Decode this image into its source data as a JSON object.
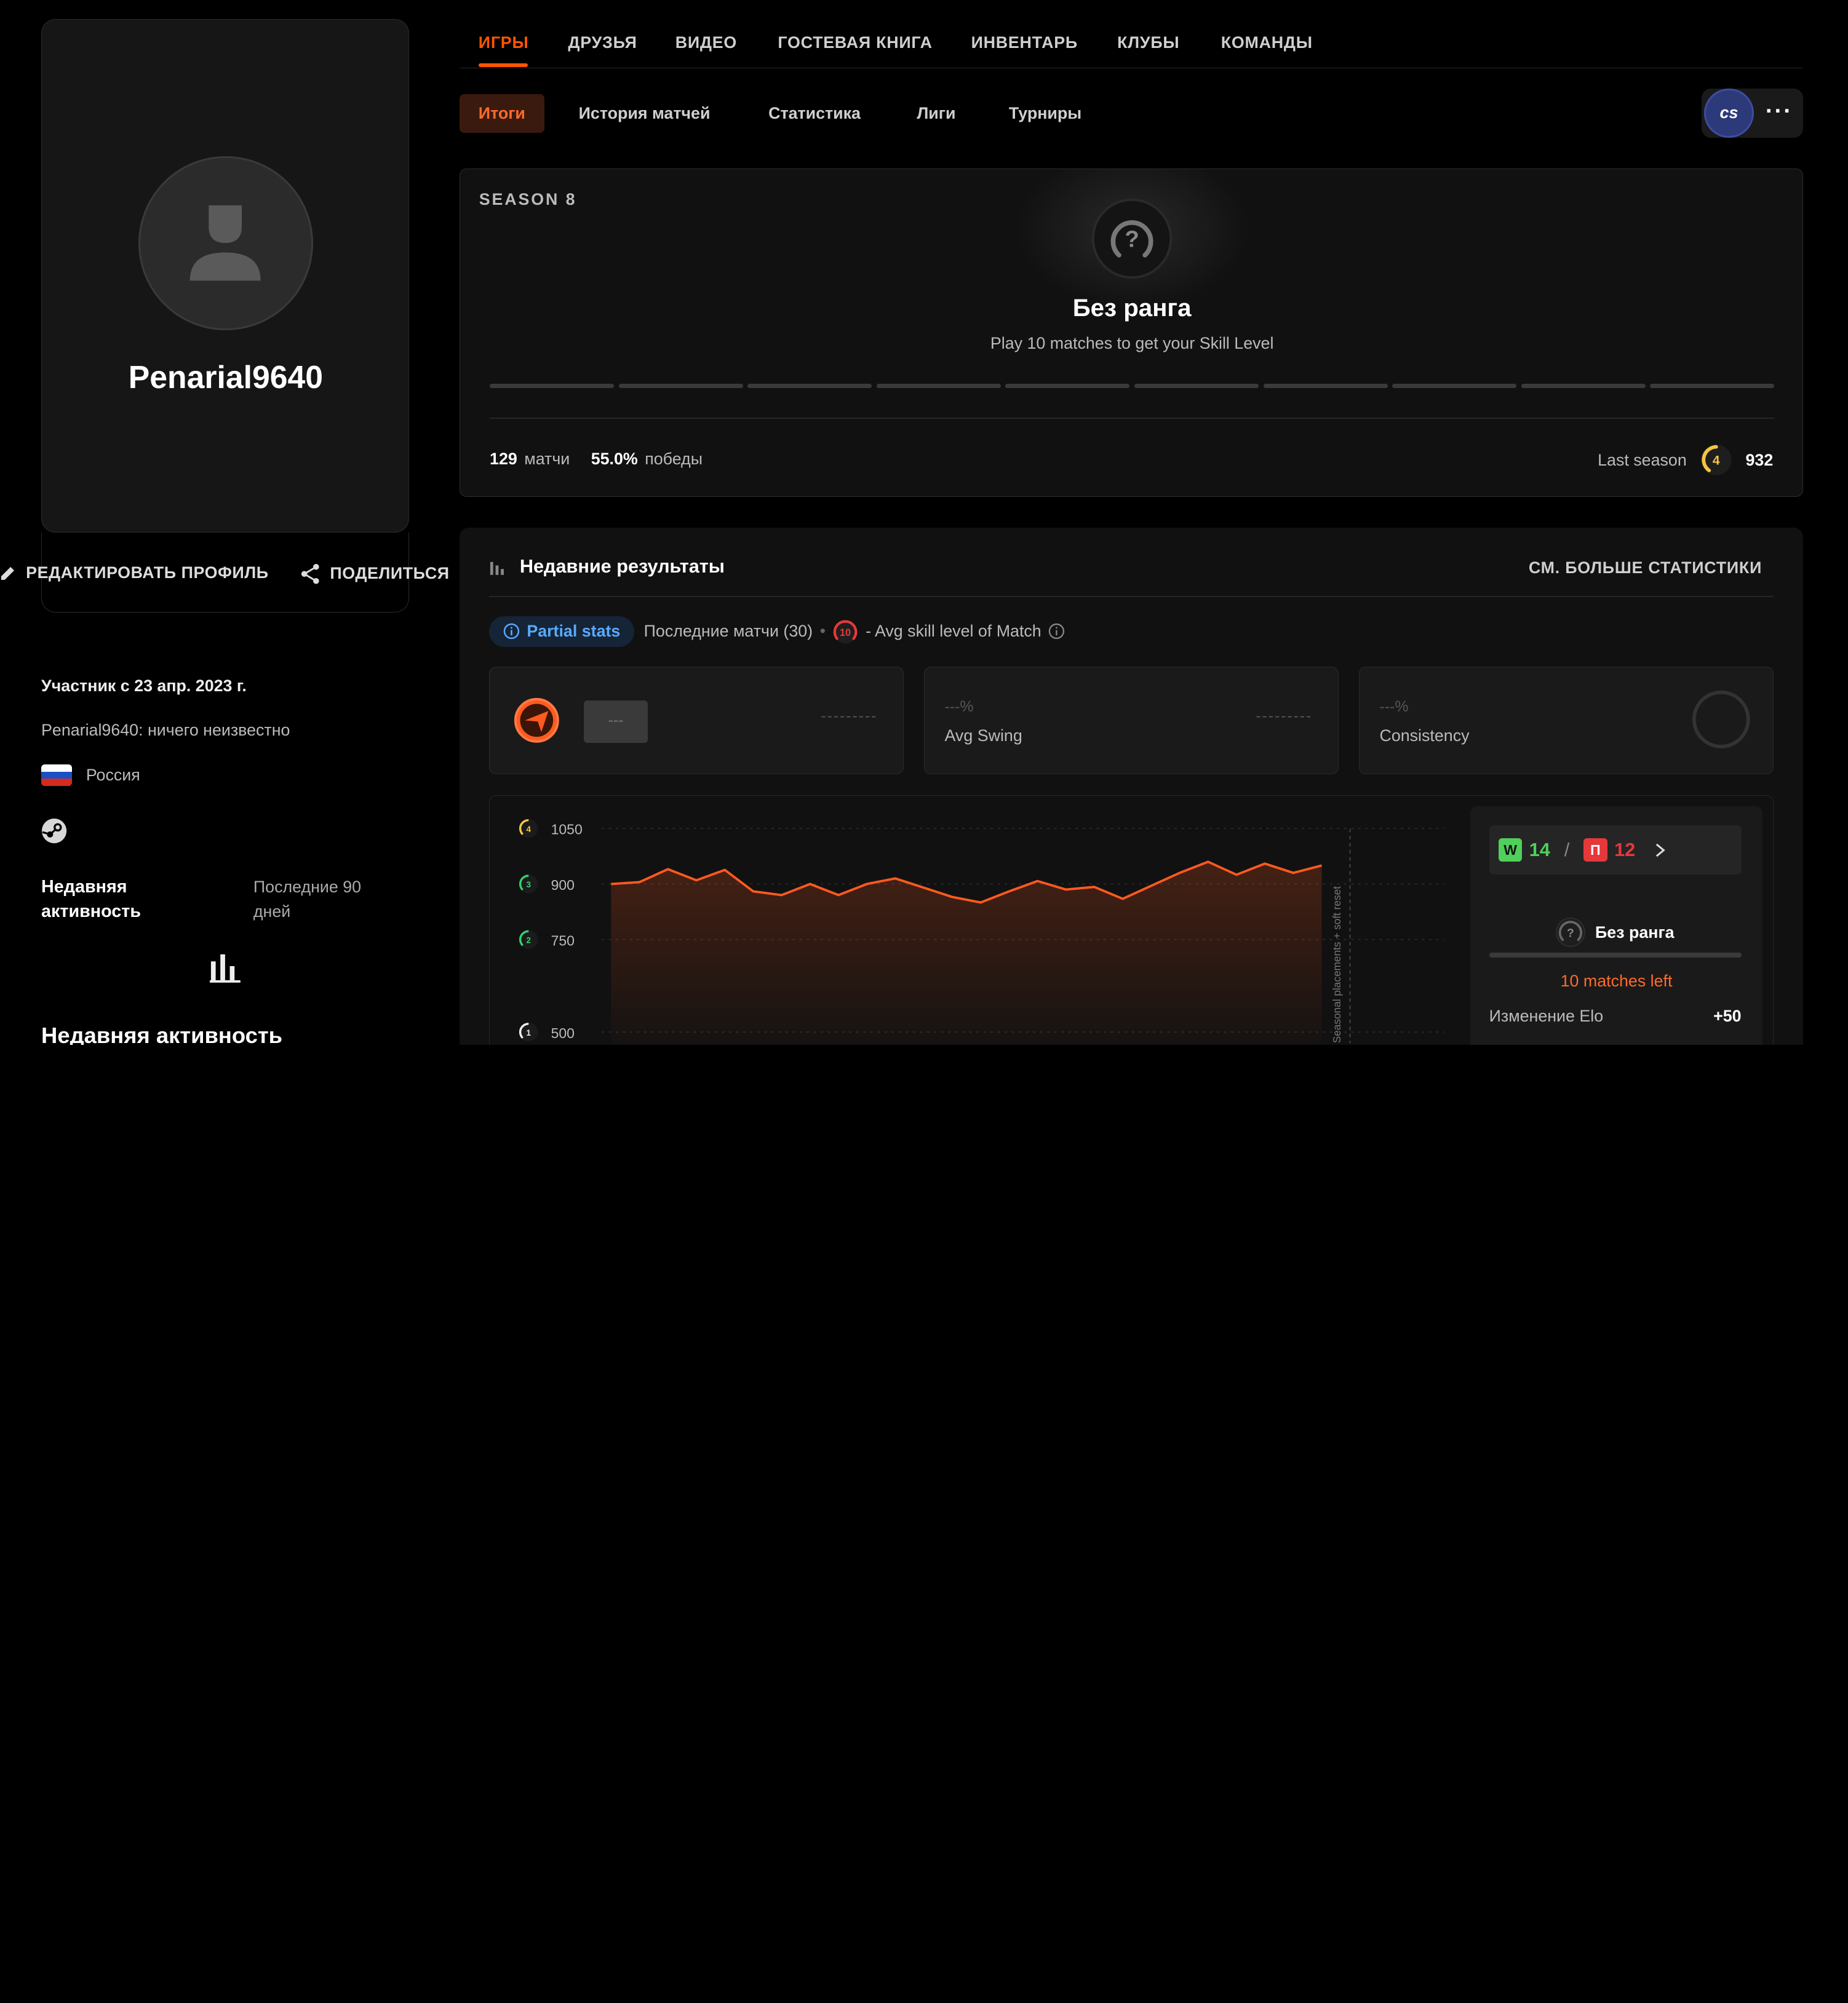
{
  "profile": {
    "username": "Penarial9640",
    "edit_label": "РЕДАКТИРОВАТЬ ПРОФИЛЬ",
    "share_label": "ПОДЕЛИТЬСЯ",
    "member_since": "Участник с 23 апр. 2023 г.",
    "about": "Penarial9640: ничего неизвестно",
    "country": "Россия",
    "activity_title": "Недавняя активность",
    "activity_period": "Последние 90 дней",
    "activity_title2": "Недавняя активность"
  },
  "nav": {
    "tabs": [
      "ИГРЫ",
      "ДРУЗЬЯ",
      "ВИДЕО",
      "ГОСТЕВАЯ КНИГА",
      "ИНВЕНТАРЬ",
      "КЛУБЫ",
      "КОМАНДЫ"
    ],
    "subtabs": [
      "Итоги",
      "История матчей",
      "Статистика",
      "Лиги",
      "Турниры"
    ],
    "game_logo": "cs",
    "more": "···"
  },
  "season": {
    "label": "SEASON 8",
    "rank_name": "Без ранга",
    "rank_hint": "Play 10 matches to get your Skill Level",
    "matches_value": "129",
    "matches_label": "матчи",
    "wins_value": "55.0%",
    "wins_label": "победы",
    "last_season_label": "Last season",
    "last_season_level": "4",
    "last_season_elo": "932",
    "progress_segments": 10,
    "progress_filled": 0
  },
  "recent": {
    "title": "Недавние результаты",
    "see_more": "СМ. БОЛЬШЕ СТАТИСТИКИ",
    "partial_stats": "Partial stats",
    "last_matches": "Последние матчи (30)",
    "skill_badge": "10",
    "avg_skill_label": "- Avg skill level of Match",
    "stat1_placeholder": "---",
    "stat1_dashes": "---------",
    "avg_swing_pct": "---%",
    "avg_swing_label": "Avg Swing",
    "avg_swing_dashes": "---------",
    "consistency_pct": "---%",
    "consistency_label": "Consistency"
  },
  "chart_data": {
    "type": "area",
    "y_ticks": [
      {
        "level": "4",
        "value": "1050",
        "color": "#f5c542"
      },
      {
        "level": "3",
        "value": "900",
        "color": "#2fd36b"
      },
      {
        "level": "2",
        "value": "750",
        "color": "#2fd36b"
      },
      {
        "level": "1",
        "value": "500",
        "color": "#eeeeee"
      }
    ],
    "ylim": [
      470,
      1100
    ],
    "values": [
      900,
      905,
      940,
      910,
      938,
      880,
      870,
      900,
      870,
      900,
      915,
      890,
      865,
      850,
      880,
      908,
      885,
      892,
      860,
      895,
      930,
      960,
      925,
      955,
      930,
      950
    ],
    "annotation": "Seasonal placements + soft reset",
    "color": "#ff5a1f"
  },
  "panel": {
    "w_tag": "W",
    "wins": "14",
    "separator": "/",
    "l_tag": "П",
    "losses": "12",
    "rank": "Без ранга",
    "matches_left": "10 matches left",
    "elo_label": "Изменение Elo",
    "elo_value": "+50"
  },
  "colors": {
    "accent": "#ff5500",
    "win": "#4fd05a",
    "loss": "#e5383b"
  }
}
